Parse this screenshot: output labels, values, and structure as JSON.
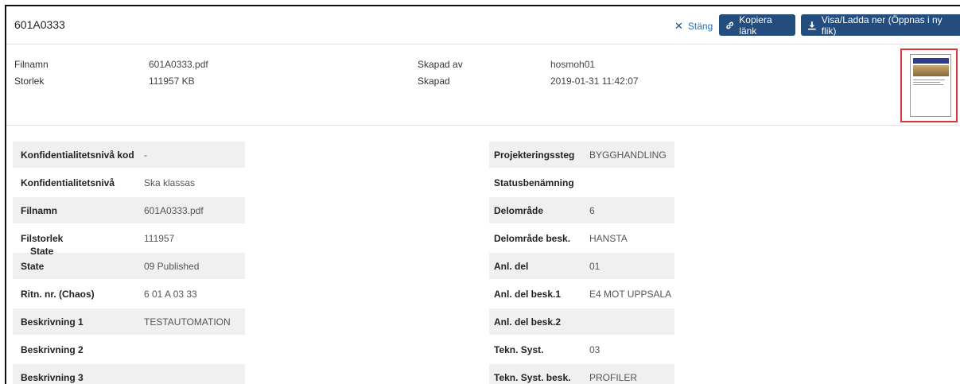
{
  "header": {
    "doc_id": "601A0333",
    "close_label": "Stäng",
    "copy_link_label": "Kopiera länk",
    "view_download_label": "Visa/Ladda ner (Öppnas i ny flik)"
  },
  "meta": {
    "filename_label": "Filnamn",
    "filename_value": "601A0333.pdf",
    "size_label": "Storlek",
    "size_value": "111957 KB",
    "created_by_label": "Skapad av",
    "created_by_value": "hosmoh01",
    "created_label": "Skapad",
    "created_value": "2019-01-31 11:42:07"
  },
  "left_props": [
    {
      "key": "Konfidentialitetsnivå kod",
      "value": "-"
    },
    {
      "key": "Konfidentialitetsnivå",
      "value": "Ska klassas"
    },
    {
      "key": "Filnamn",
      "value": "601A0333.pdf"
    },
    {
      "key": "Filstorlek",
      "value": "111957"
    },
    {
      "key": "State",
      "value": "09 Published"
    },
    {
      "key": "Ritn. nr. (Chaos)",
      "value": "6 01 A 03 33"
    },
    {
      "key": "Beskrivning 1",
      "value": "TESTAUTOMATION"
    },
    {
      "key": "Beskrivning 2",
      "value": ""
    },
    {
      "key": "Beskrivning 3",
      "value": ""
    }
  ],
  "right_props": [
    {
      "key": "Projekteringssteg",
      "value": "BYGGHANDLING"
    },
    {
      "key": "Statusbenämning",
      "value": ""
    },
    {
      "key": "Delområde",
      "value": "6"
    },
    {
      "key": "Delområde besk.",
      "value": "HANSTA"
    },
    {
      "key": "Anl. del",
      "value": "01"
    },
    {
      "key": "Anl. del besk.1",
      "value": "E4 MOT UPPSALA"
    },
    {
      "key": "Anl. del besk.2",
      "value": ""
    },
    {
      "key": "Tekn. Syst.",
      "value": "03"
    },
    {
      "key": "Tekn. Syst. besk.",
      "value": "PROFILER"
    }
  ],
  "overlay": {
    "drag_label": "State"
  },
  "colors": {
    "primary": "#234d7e",
    "link": "#2c6fb5",
    "highlight": "#d9363e",
    "row_shade": "#f0f0f0"
  }
}
